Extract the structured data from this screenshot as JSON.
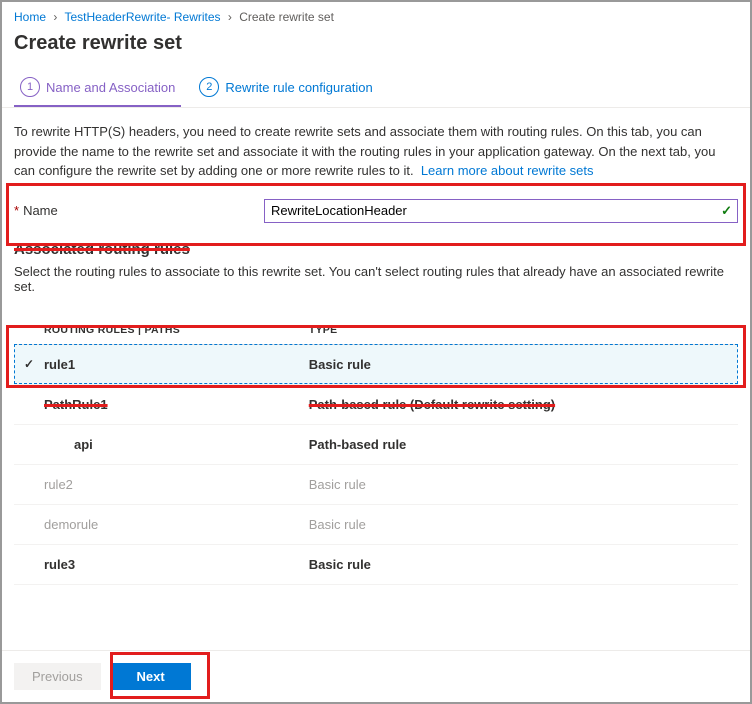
{
  "breadcrumb": {
    "home": "Home",
    "resource": "TestHeaderRewrite- Rewrites",
    "current": "Create rewrite set"
  },
  "page_title": "Create rewrite set",
  "tabs": {
    "step1_num": "1",
    "step1_label": "Name and Association",
    "step2_num": "2",
    "step2_label": "Rewrite rule configuration"
  },
  "intro": {
    "text": "To rewrite HTTP(S) headers, you need to create rewrite sets and associate them with routing rules. On this tab, you can provide the name to the rewrite set and associate it with the routing rules in your application gateway. On the next tab, you can configure the rewrite set by adding one or more rewrite rules to it.",
    "link": "Learn more about rewrite sets"
  },
  "form": {
    "name_label": "Name",
    "name_value": "RewriteLocationHeader"
  },
  "section": {
    "title": "Associated routing rules",
    "desc": "Select the routing rules to associate to this rewrite set. You can't select routing rules that already have an associated rewrite set."
  },
  "table": {
    "col1": "ROUTING RULES | PATHS",
    "col2": "TYPE",
    "rows": [
      {
        "name": "rule1",
        "type": "Basic rule",
        "state": "selected"
      },
      {
        "name": "PathRule1",
        "type": "Path-based rule (Default rewrite setting)",
        "state": "strike"
      },
      {
        "name": "api",
        "type": "Path-based rule",
        "state": "nested"
      },
      {
        "name": "rule2",
        "type": "Basic rule",
        "state": "disabled"
      },
      {
        "name": "demorule",
        "type": "Basic rule",
        "state": "disabled"
      },
      {
        "name": "rule3",
        "type": "Basic rule",
        "state": "bold"
      }
    ]
  },
  "footer": {
    "prev": "Previous",
    "next": "Next"
  }
}
